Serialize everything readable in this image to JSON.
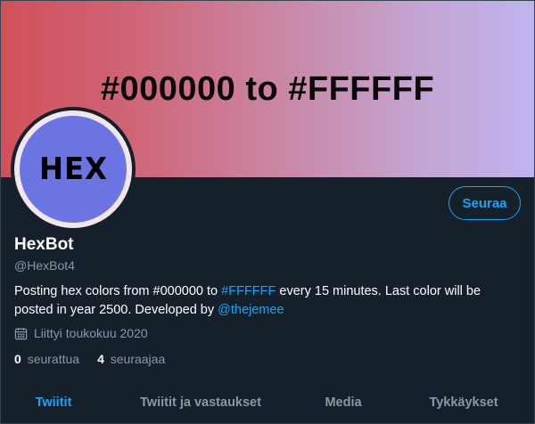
{
  "banner": {
    "text": "#000000 to #FFFFFF"
  },
  "avatar": {
    "text": "HEX"
  },
  "profile": {
    "follow_label": "Seuraa",
    "name": "HexBot",
    "handle": "@HexBot4",
    "bio_part1": "Posting hex colors from #000000 to ",
    "bio_link1": "#FFFFFF",
    "bio_part2": " every 15 minutes. Last color will be posted in year 2500. Developed by ",
    "bio_link2": "@thejemee",
    "joined": "Liittyi toukokuu 2020",
    "following_count": "0",
    "following_label": "seurattua",
    "followers_count": "4",
    "followers_label": "seuraajaa"
  },
  "tabs": [
    {
      "label": "Twiitit",
      "active": true
    },
    {
      "label": "Twiitit ja vastaukset",
      "active": false
    },
    {
      "label": "Media",
      "active": false
    },
    {
      "label": "Tykkäykset",
      "active": false
    }
  ],
  "colors": {
    "background": "#15202b",
    "accent": "#1da1f2",
    "secondary_text": "#8899a6",
    "avatar_fill": "#6a74e3"
  },
  "icons": {
    "joined": "calendar-icon"
  }
}
